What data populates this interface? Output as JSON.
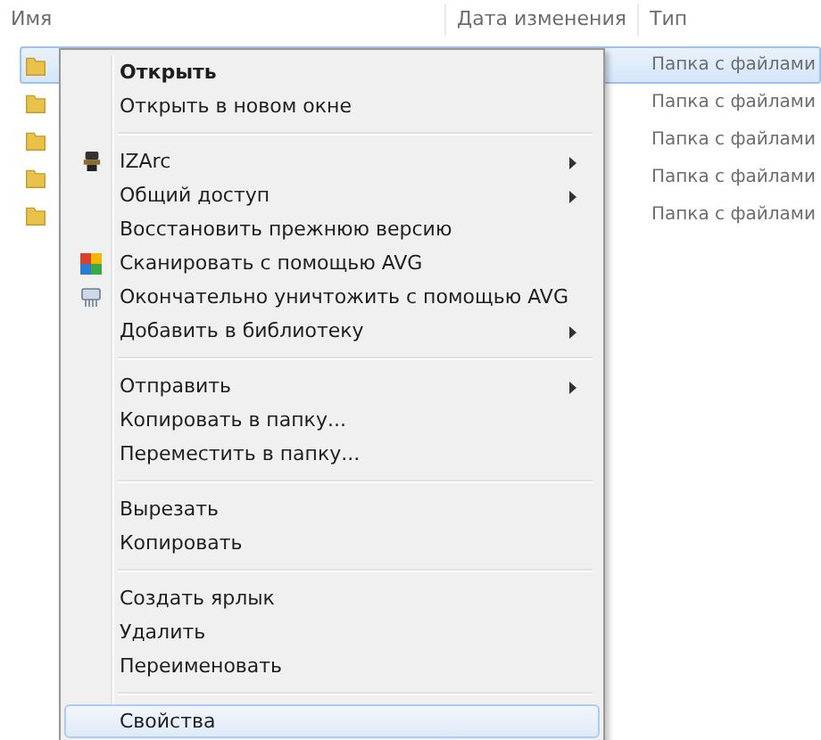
{
  "columns": [
    {
      "label": "Имя"
    },
    {
      "label": "Дата изменения"
    },
    {
      "label": "Тип"
    }
  ],
  "rows": [
    {
      "type": "Папка с файлами",
      "selected": true
    },
    {
      "type": "Папка с файлами",
      "selected": false
    },
    {
      "type": "Папка с файлами",
      "selected": false
    },
    {
      "type": "Папка с файлами",
      "selected": false
    },
    {
      "type": "Папка с файлами",
      "selected": false
    }
  ],
  "context_menu": {
    "items": [
      {
        "kind": "item",
        "label": "Открыть",
        "default": true,
        "submenu": false,
        "selected": false
      },
      {
        "kind": "item",
        "label": "Открыть в новом окне",
        "default": false,
        "submenu": false,
        "selected": false
      },
      {
        "kind": "separator"
      },
      {
        "kind": "item",
        "label": "IZArc",
        "default": false,
        "submenu": true,
        "selected": false
      },
      {
        "kind": "item",
        "label": "Общий доступ",
        "default": false,
        "submenu": true,
        "selected": false
      },
      {
        "kind": "item",
        "label": "Восстановить прежнюю версию",
        "default": false,
        "submenu": false,
        "selected": false
      },
      {
        "kind": "item",
        "label": "Сканировать с помощью AVG",
        "default": false,
        "submenu": false,
        "selected": false
      },
      {
        "kind": "item",
        "label": "Окончательно уничтожить с помощью AVG",
        "default": false,
        "submenu": false,
        "selected": false
      },
      {
        "kind": "item",
        "label": "Добавить в библиотеку",
        "default": false,
        "submenu": true,
        "selected": false
      },
      {
        "kind": "separator"
      },
      {
        "kind": "item",
        "label": "Отправить",
        "default": false,
        "submenu": true,
        "selected": false
      },
      {
        "kind": "item",
        "label": "Копировать в папку...",
        "default": false,
        "submenu": false,
        "selected": false
      },
      {
        "kind": "item",
        "label": "Переместить в папку...",
        "default": false,
        "submenu": false,
        "selected": false
      },
      {
        "kind": "separator"
      },
      {
        "kind": "item",
        "label": "Вырезать",
        "default": false,
        "submenu": false,
        "selected": false
      },
      {
        "kind": "item",
        "label": "Копировать",
        "default": false,
        "submenu": false,
        "selected": false
      },
      {
        "kind": "separator"
      },
      {
        "kind": "item",
        "label": "Создать ярлык",
        "default": false,
        "submenu": false,
        "selected": false
      },
      {
        "kind": "item",
        "label": "Удалить",
        "default": false,
        "submenu": false,
        "selected": false
      },
      {
        "kind": "item",
        "label": "Переименовать",
        "default": false,
        "submenu": false,
        "selected": false
      },
      {
        "kind": "separator"
      },
      {
        "kind": "item",
        "label": "Свойства",
        "default": false,
        "submenu": false,
        "selected": true
      }
    ]
  }
}
